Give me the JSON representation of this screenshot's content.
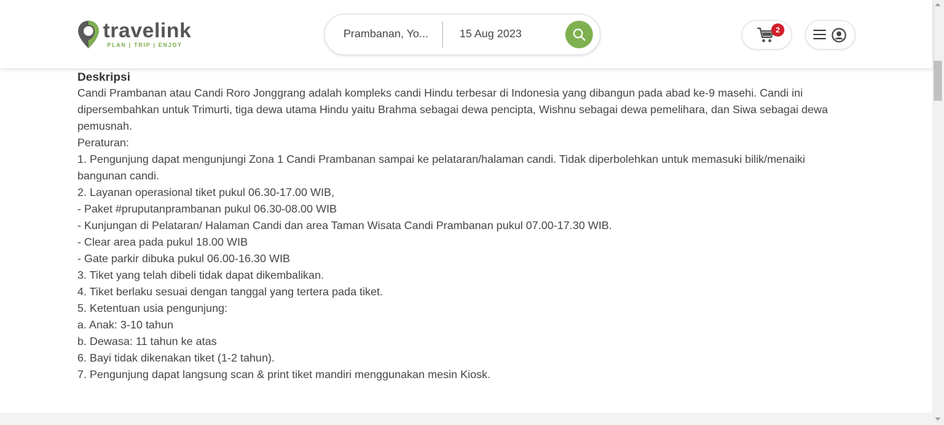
{
  "brand": {
    "name": "travelink",
    "tagline": "PLAN | TRIP | ENJOY",
    "accent": "#7fb04f"
  },
  "search": {
    "location": "Prambanan, Yo...",
    "date": "15 Aug 2023",
    "button_icon": "search-icon"
  },
  "cart": {
    "count": "2",
    "icon": "cart-icon"
  },
  "menu": {
    "icons": [
      "hamburger-icon",
      "user-avatar-icon"
    ]
  },
  "description": {
    "title": "Deskripsi",
    "intro": "Candi Prambanan atau Candi Roro Jonggrang adalah kompleks candi Hindu terbesar di Indonesia yang dibangun pada abad ke-9 masehi. Candi ini dipersembahkan untuk Trimurti, tiga dewa utama Hindu yaitu Brahma sebagai dewa pencipta, Wishnu sebagai dewa pemelihara, dan Siwa sebagai dewa pemusnah.",
    "lines": [
      "Peraturan:",
      "1. Pengunjung dapat mengunjungi Zona 1 Candi Prambanan sampai ke pelataran/halaman candi. Tidak diperbolehkan untuk memasuki bilik/menaiki bangunan candi.",
      "2. Layanan operasional tiket pukul 06.30-17.00 WIB,",
      "- Paket #pruputanprambanan pukul 06.30-08.00 WIB",
      "- Kunjungan di Pelataran/ Halaman Candi dan area Taman Wisata Candi Prambanan pukul 07.00-17.30 WIB.",
      "- Clear area pada pukul 18.00 WIB",
      "- Gate parkir dibuka pukul 06.00-16.30 WIB",
      "3. Tiket yang telah dibeli tidak dapat dikembalikan.",
      "4. Tiket berlaku sesuai dengan tanggal yang tertera pada tiket.",
      "5. Ketentuan usia pengunjung:",
      "a. Anak: 3-10 tahun",
      "b. Dewasa: 11 tahun ke atas",
      "6. Bayi tidak dikenakan tiket (1-2 tahun).",
      "7. Pengunjung dapat langsung scan & print tiket mandiri menggunakan mesin Kiosk."
    ]
  }
}
